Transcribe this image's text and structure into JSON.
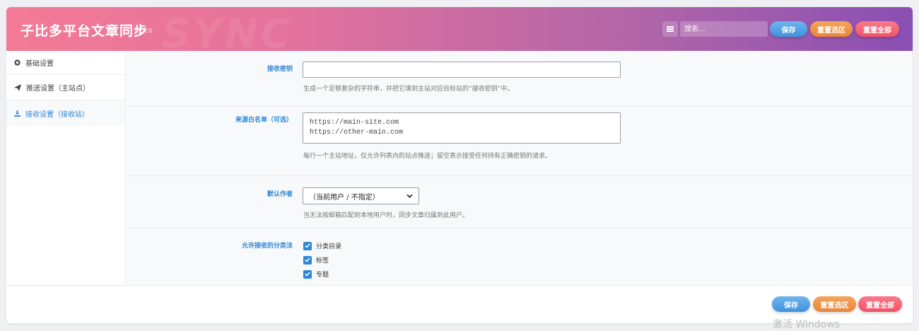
{
  "header": {
    "title": "子比多平台文章同步",
    "version": "v1.0.0",
    "search_placeholder": "搜索...",
    "save_label": "保存",
    "reset_section_label": "重置选区",
    "reset_all_label": "重置全部"
  },
  "sidebar": {
    "items": [
      {
        "label": "基础设置",
        "icon": "gear-icon"
      },
      {
        "label": "推送设置（主站点）",
        "icon": "paper-plane-icon"
      },
      {
        "label": "接收设置（接收站）",
        "icon": "download-icon",
        "active": true
      }
    ]
  },
  "form": {
    "secret": {
      "label": "接收密钥",
      "value": "",
      "description": "生成一个足够复杂的字符串，并把它填到主站对应目标站的“接收密钥”中。"
    },
    "whitelist": {
      "label": "来源白名单（可选）",
      "value": "https://main-site.com\nhttps://other-main.com",
      "description": "每行一个主站地址，仅允许列表内的站点推送；留空表示接受任何持有正确密钥的请求。"
    },
    "author": {
      "label": "默认作者",
      "selected": "（当前用户 / 不指定）",
      "description": "当无法按邮箱匹配到本地用户时，同步文章归属到此用户。"
    },
    "taxonomies": {
      "label": "允许接收的分类法",
      "options": [
        {
          "label": "分类目录",
          "checked": true
        },
        {
          "label": "标签",
          "checked": true
        },
        {
          "label": "专题",
          "checked": true
        }
      ]
    }
  },
  "footer": {
    "save_label": "保存",
    "reset_section_label": "重置选区",
    "reset_all_label": "重置全部"
  },
  "watermark": "激活 Windows",
  "colors": {
    "accent": "#2f87d8",
    "save": "#4a9be3",
    "reset_section": "#ee9246",
    "reset_all": "#f3606f"
  }
}
